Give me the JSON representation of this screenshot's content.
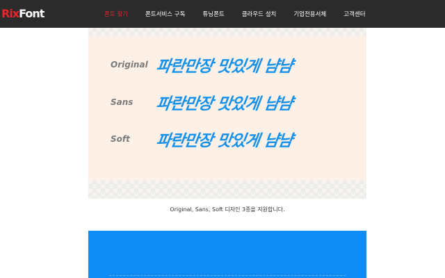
{
  "brand": {
    "logo_part1": "Rix",
    "logo_part2": "Font"
  },
  "nav": {
    "items": [
      {
        "label": "폰트 찾기",
        "active": true
      },
      {
        "label": "폰트서비스 구독",
        "active": false
      },
      {
        "label": "튜닝폰트",
        "active": false
      },
      {
        "label": "클라우드 설치",
        "active": false
      },
      {
        "label": "기업전용서체",
        "active": false
      },
      {
        "label": "고객센터",
        "active": false
      }
    ]
  },
  "samples": [
    {
      "style": "Original",
      "text": "파란만장 맛있게 냠냠"
    },
    {
      "style": "Sans",
      "text": "파란만장 맛있게 냠냠"
    },
    {
      "style": "Soft",
      "text": "파란만장 맛있게 냠냠"
    }
  ],
  "caption": "Original, Sans, Soft 디자인 3종을 지원합니다.",
  "colors": {
    "topbar": "#2b2b2b",
    "accent_red": "#e8252d",
    "sample_blue": "#1591ea",
    "hero_bg": "#fdf1e7",
    "blue_panel": "#0f8bf6"
  }
}
